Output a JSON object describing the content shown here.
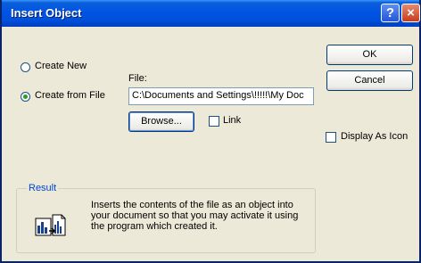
{
  "window": {
    "title": "Insert Object"
  },
  "titlebar": {
    "help_glyph": "?",
    "close_glyph": "×"
  },
  "options": {
    "create_new": "Create New",
    "create_from_file": "Create from File",
    "selected": "create_from_file"
  },
  "file": {
    "label": "File:",
    "value": "C:\\Documents and Settings\\!!!!!\\My Doc"
  },
  "buttons": {
    "ok": "OK",
    "cancel": "Cancel",
    "browse": "Browse..."
  },
  "checkboxes": {
    "link": {
      "label": "Link",
      "checked": false
    },
    "display_as_icon": {
      "label": "Display As Icon",
      "checked": false
    }
  },
  "result": {
    "legend": "Result",
    "line1": "Inserts the contents of the file as an object into",
    "line2": "your document so that you may activate it using",
    "line3": "the program which created it.",
    "icon": "insert-object-result-icon"
  },
  "colors": {
    "title_bar": "#0054e3",
    "dialog_bg": "#ece9d8",
    "group_legend": "#0046d5"
  }
}
